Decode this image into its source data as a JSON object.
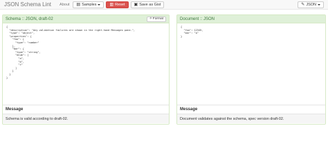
{
  "navbar": {
    "brand": "JSON Schema Lint",
    "about": "About",
    "samples": "Samples",
    "reset": "Reset",
    "save_gist": "Save as Gist",
    "json_menu": "JSON"
  },
  "schema_panel": {
    "title": "Schema :: JSON, draft-02",
    "format_button": "Format",
    "code": "{\n  \"description\": \"Any validation failures are shown in the right-hand Messages pane.\",\n  \"type\": \"object\",\n  \"properties\": {\n    \"foo\": {\n      \"type\": \"number\"\n    },\n    \"bar\": {\n      \"type\": \"string\",\n      \"enum\": [\n        \"a\",\n        \"b\",\n        \"c\"\n      ]\n    }\n  }\n}",
    "message_title": "Message",
    "message": "Schema is valid according to draft-02."
  },
  "document_panel": {
    "title": "Document :: JSON",
    "code": "{\n  \"foo\": 12345,\n  \"bar\": \"a\"\n}",
    "message_title": "Message",
    "message": "Document validates against the schema, spec version draft-02."
  },
  "colors": {
    "panel_heading_bg": "#dff0d8",
    "panel_heading_text": "#3c763d",
    "reset_button": "#d9534f"
  }
}
